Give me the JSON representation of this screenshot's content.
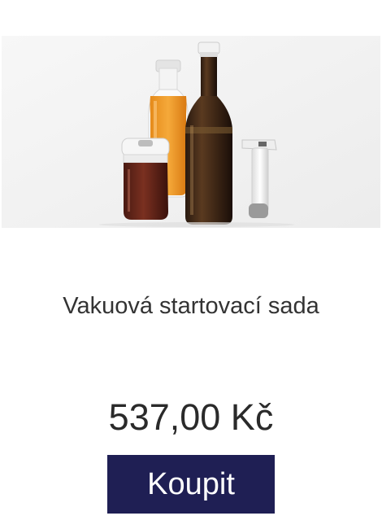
{
  "product": {
    "name": "Vakuová startovací sada",
    "price": "537,00 Kč",
    "buy_label": "Koupit"
  },
  "colors": {
    "button_bg": "#1f1f54",
    "button_text": "#ffffff",
    "text": "#333333",
    "image_bg": "#f2f2f2"
  },
  "image": {
    "items": [
      "jam-jar-with-vacuum-lid",
      "juice-bottle-with-vacuum-stopper",
      "wine-bottle-with-vacuum-stopper",
      "vacuum-pump"
    ]
  }
}
